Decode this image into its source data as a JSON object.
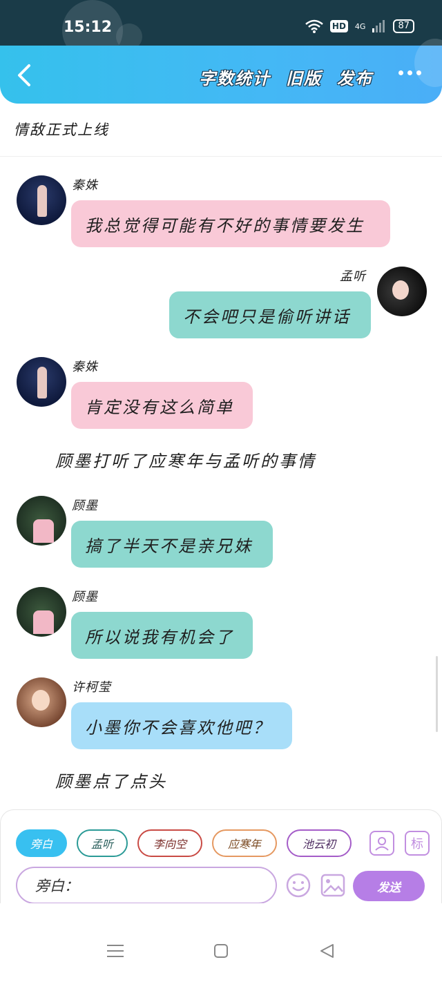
{
  "status_bar": {
    "time": "15:12",
    "hd": "HD",
    "network": "4G",
    "battery": "87"
  },
  "header": {
    "back_icon": "chevron-left-icon",
    "actions": [
      "字数统计",
      "旧版",
      "发布"
    ],
    "more_icon": "more-dots-icon"
  },
  "story": {
    "title": "情敌正式上线"
  },
  "messages": [
    {
      "type": "speech",
      "side": "left",
      "speaker": "秦姝",
      "text": "我总觉得可能有不好的事情要发生",
      "color": "#f9c9d7"
    },
    {
      "type": "speech",
      "side": "right",
      "speaker": "孟听",
      "text": "不会吧只是偷听讲话",
      "color": "#8dd8cf"
    },
    {
      "type": "speech",
      "side": "left",
      "speaker": "秦姝",
      "text": "肯定没有这么简单",
      "color": "#f9c9d7"
    },
    {
      "type": "narration",
      "text": "顾墨打听了应寒年与孟听的事情"
    },
    {
      "type": "speech",
      "side": "left",
      "speaker": "顾墨",
      "text": "搞了半天不是亲兄妹",
      "color": "#8dd8cf"
    },
    {
      "type": "speech",
      "side": "left",
      "speaker": "顾墨",
      "text": "所以说我有机会了",
      "color": "#8dd8cf"
    },
    {
      "type": "speech",
      "side": "left",
      "speaker": "许柯莹",
      "text": "小墨你不会喜欢他吧？",
      "color": "#a8def9"
    },
    {
      "type": "narration",
      "text": "顾墨点了点头"
    }
  ],
  "composer": {
    "roles": [
      "旁白",
      "孟听",
      "李向空",
      "应寒年",
      "池云初"
    ],
    "active_role": "旁白",
    "input_prefix": "旁白：",
    "role_icon": "user-card-icon",
    "tag_icon_label": "标",
    "emoji_icon": "smiley-icon",
    "image_icon": "image-icon",
    "send_label": "发送",
    "accent": "#b67ee6"
  },
  "nav": {
    "menu_icon": "menu-icon",
    "home_icon": "home-square-icon",
    "back_icon": "back-triangle-icon"
  }
}
